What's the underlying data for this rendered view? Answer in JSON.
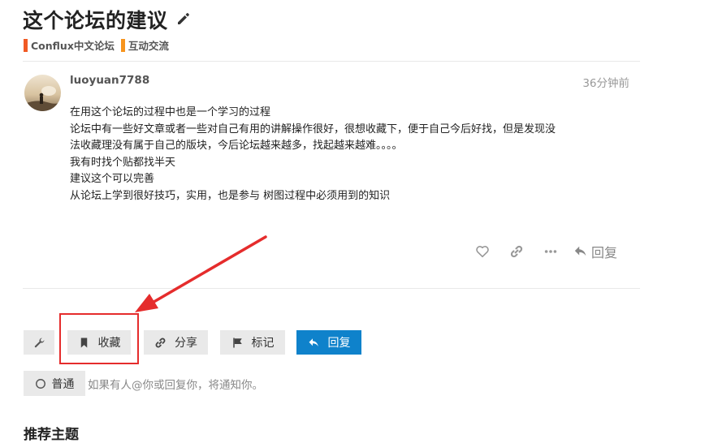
{
  "topic": {
    "title": "这个论坛的建议",
    "categories": [
      {
        "name": "Conflux中文论坛",
        "color": "#f15a24"
      },
      {
        "name": "互动交流",
        "color": "#f7941d"
      }
    ]
  },
  "post": {
    "username": "luoyuan7788",
    "time": "36分钟前",
    "lines": [
      "在用这个论坛的过程中也是一个学习的过程",
      "论坛中有一些好文章或者一些对自己有用的讲解操作很好，很想收藏下，便于自己今后好找，但是发现没",
      "法收藏理没有属于自己的版块，今后论坛越来越多，找起越来越难。。。。",
      "我有时找个贴都找半天",
      "建议这个可以完善",
      "从论坛上学到很好技巧，实用，也是参与 树图过程中必须用到的知识"
    ],
    "reply_label": "回复"
  },
  "footer_buttons": {
    "bookmark": "收藏",
    "share": "分享",
    "flag": "标记",
    "reply": "回复"
  },
  "notification": {
    "level": "普通",
    "description": "如果有人@你或回复你，将通知你。"
  },
  "suggested_heading": "推荐主题",
  "colors": {
    "primary": "#0f82cb",
    "annotation": "#e52c2c"
  }
}
